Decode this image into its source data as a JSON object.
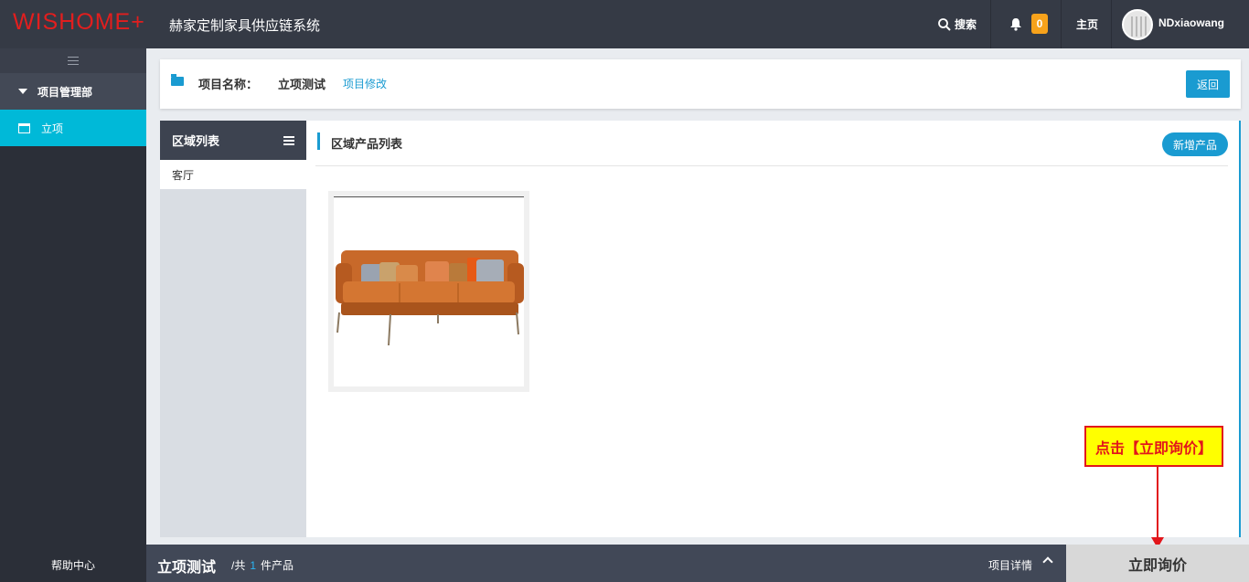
{
  "header": {
    "logo": "WISHOME+",
    "system_title": "赫家定制家具供应链系统",
    "search_label": "搜索",
    "notification_count": "0",
    "home_label": "主页",
    "username": "NDxiaowang"
  },
  "sidebar": {
    "group_label": "项目管理部",
    "items": [
      {
        "label": "立项",
        "icon": "calendar-icon",
        "active": true
      }
    ],
    "help_label": "帮助中心"
  },
  "project": {
    "name_label": "项目名称：",
    "name": "立项测试",
    "edit_link": "项目修改",
    "back_button": "返回"
  },
  "regions": {
    "title": "区域列表",
    "items": [
      "客厅"
    ]
  },
  "products": {
    "title": "区域产品列表",
    "add_button": "新增产品",
    "items": [
      {
        "image": "orange-leather-sofa"
      }
    ]
  },
  "annotation": {
    "text": "点击【立即询价】"
  },
  "bottom": {
    "project_name": "立项测试",
    "count_prefix": "/共",
    "count": "1",
    "count_suffix": "件产品",
    "detail_label": "项目详情",
    "inquire_button": "立即询价"
  },
  "colors": {
    "accent": "#1a9bd1",
    "sidebar_active": "#00b9d8",
    "logo": "#e21e1e",
    "topbar": "#353a45",
    "annotation_bg": "#ffff00",
    "annotation_border": "#e2161b"
  }
}
